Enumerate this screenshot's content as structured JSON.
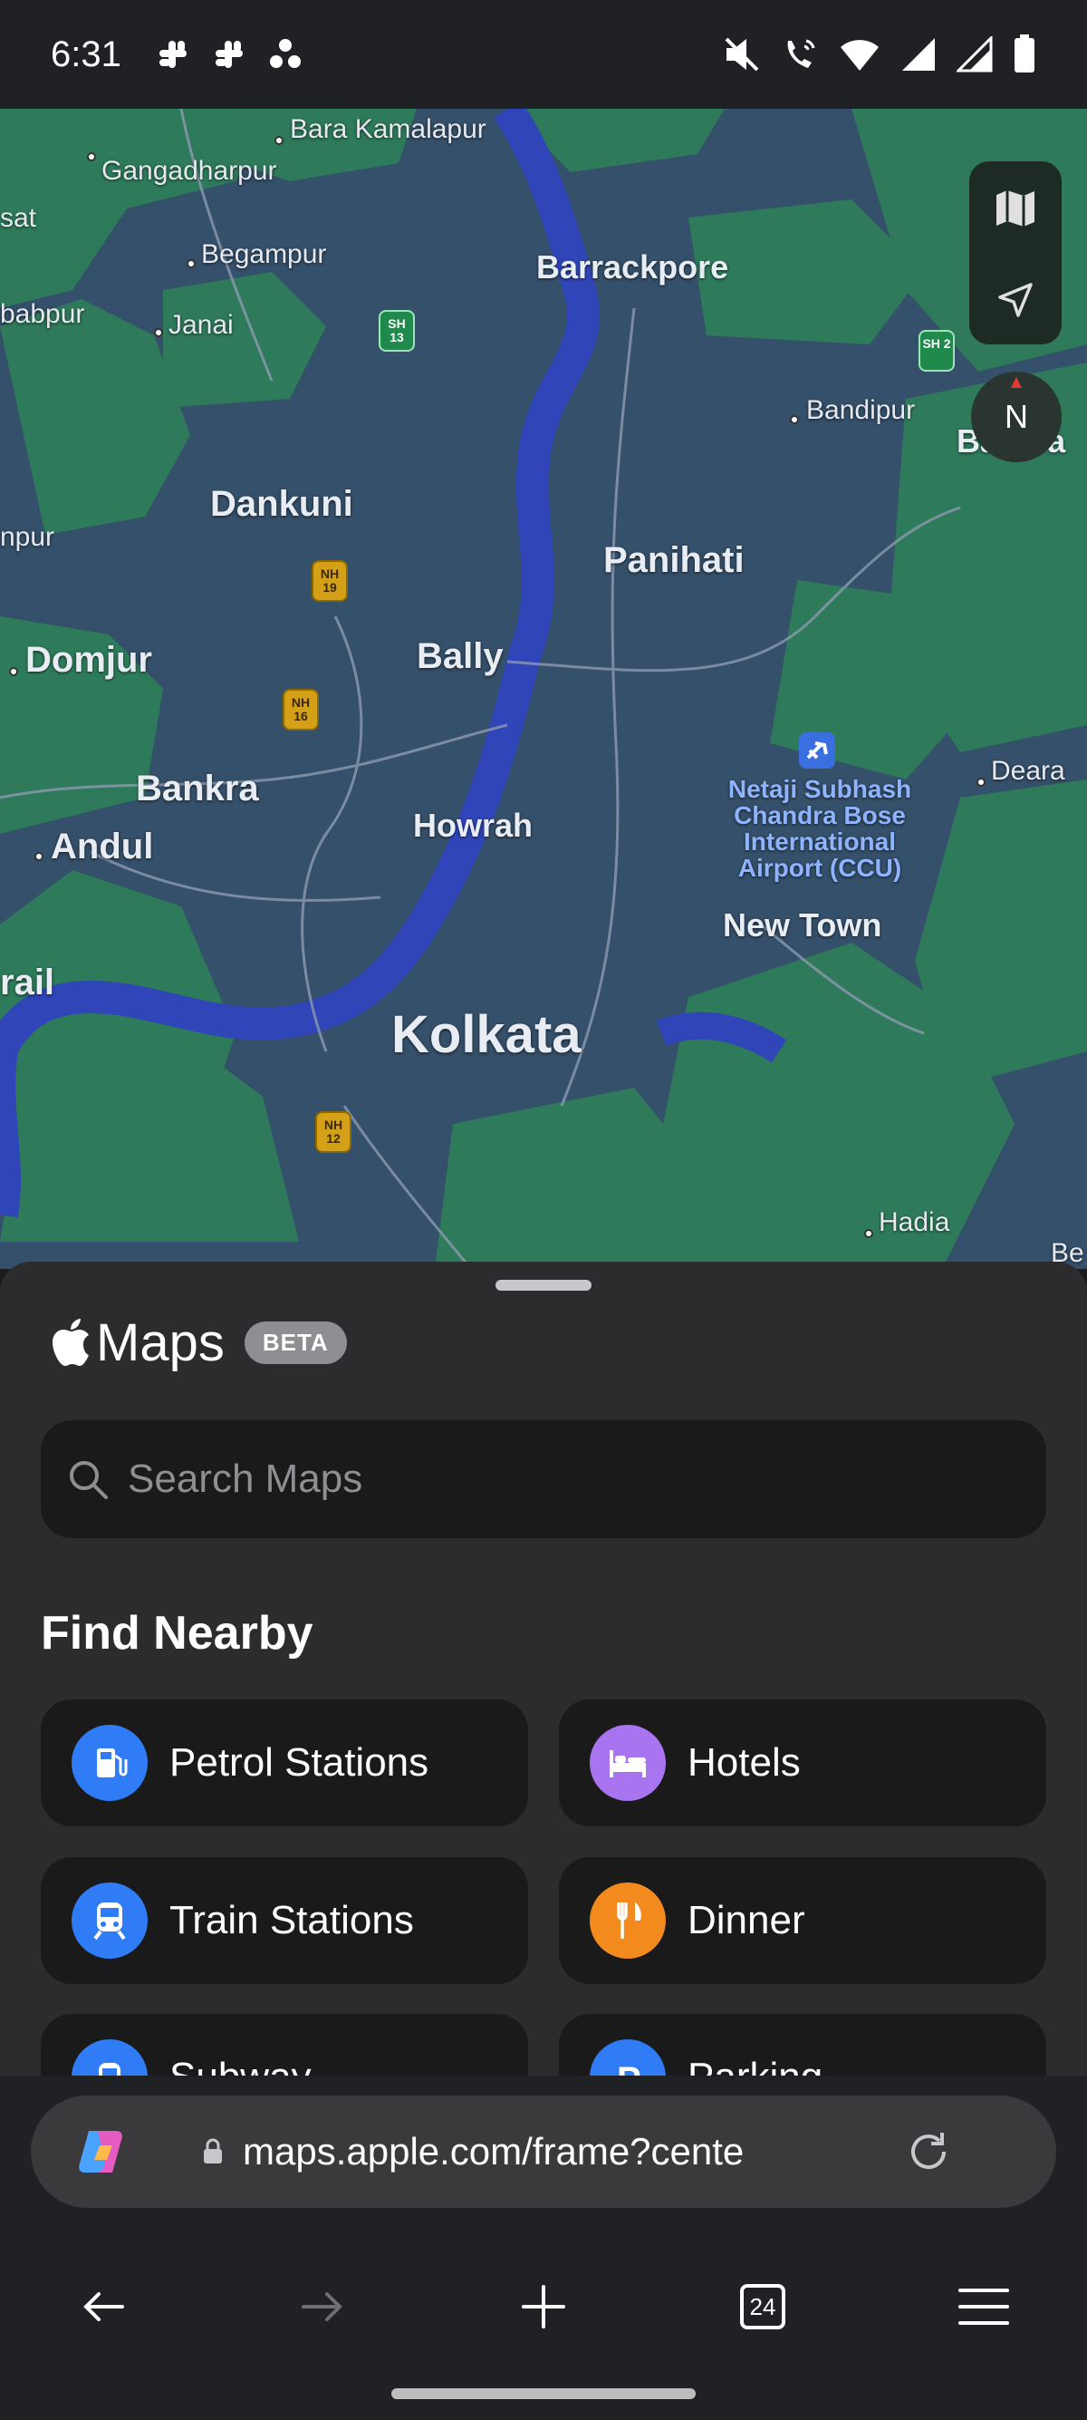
{
  "status_bar": {
    "time": "6:31",
    "icons": [
      "slack-icon",
      "slack-icon",
      "dots-icon",
      "mute-icon",
      "wifi-calling-icon",
      "wifi-icon",
      "signal-icon",
      "signal-icon",
      "battery-icon"
    ]
  },
  "map": {
    "labels": {
      "bara_kamalapur": "Bara Kamalapur",
      "gangadharpur": "Gangadharpur",
      "sat": "sat",
      "begampur": "Begampur",
      "babpur": "babpur",
      "janai": "Janai",
      "barrackpore": "Barrackpore",
      "bandipur": "Bandipur",
      "barasat_partial": "Barasa",
      "dankuni": "Dankuni",
      "npur": "npur",
      "panihati": "Panihati",
      "domjur": "Domjur",
      "bally": "Bally",
      "bankra": "Bankra",
      "deara": "Deara",
      "andul": "Andul",
      "howrah": "Howrah",
      "airport": "Netaji Subhash Chandra Bose International Airport (CCU)",
      "new_town": "New Town",
      "rail": "rail",
      "kolkata": "Kolkata",
      "hadia": "Hadia",
      "be": "Be"
    },
    "shields": {
      "sh13": "SH 13",
      "sh2": "SH 2",
      "nh19": "NH 19",
      "nh16": "NH 16",
      "nh12": "NH 12"
    },
    "compass_label": "N",
    "colors": {
      "urban": "#35506a",
      "green": "#2e7d5b",
      "river": "#2f45b8"
    }
  },
  "sheet": {
    "brand_name": "Maps",
    "beta_label": "BETA",
    "search_placeholder": "Search Maps",
    "section_title": "Find Nearby",
    "nearby": [
      {
        "label": "Petrol Stations",
        "icon": "fuel-icon",
        "color": "#2f7cf6"
      },
      {
        "label": "Hotels",
        "icon": "bed-icon",
        "color": "#a974f0"
      },
      {
        "label": "Train Stations",
        "icon": "train-icon",
        "color": "#2f7cf6"
      },
      {
        "label": "Dinner",
        "icon": "fork-knife-icon",
        "color": "#f28a1e"
      },
      {
        "label": "Subway",
        "icon": "subway-icon",
        "color": "#2f7cf6"
      },
      {
        "label": "Parking",
        "icon": "parking-icon",
        "color": "#2f7cf6"
      }
    ]
  },
  "browser": {
    "url": "maps.apple.com/frame?cente",
    "tab_count": "24"
  }
}
